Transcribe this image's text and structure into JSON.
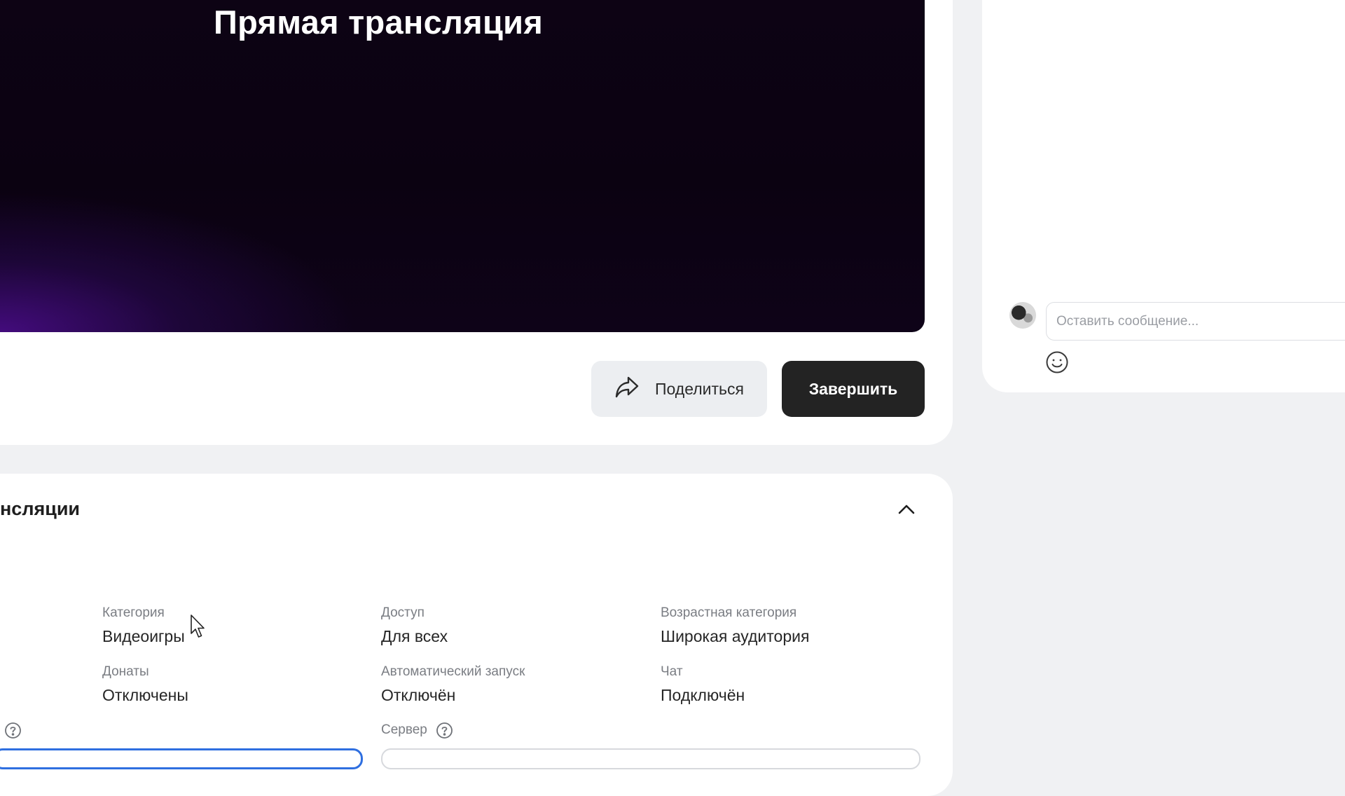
{
  "video": {
    "title": "Прямая трансляция"
  },
  "actions": {
    "share_label": "Поделиться",
    "share_icon": "share-arrow-icon",
    "finish_label": "Завершить"
  },
  "settings": {
    "title_partial": "нсляции",
    "collapse_icon": "chevron-up-icon",
    "fields": {
      "category": {
        "label": "Категория",
        "value": "Видеоигры"
      },
      "access": {
        "label": "Доступ",
        "value": "Для всех"
      },
      "age": {
        "label": "Возрастная категория",
        "value": "Широкая аудитория"
      },
      "donations": {
        "label": "Донаты",
        "value": "Отключены"
      },
      "autostart": {
        "label": "Автоматический запуск",
        "value": "Отключён"
      },
      "chat": {
        "label": "Чат",
        "value": "Подключён"
      },
      "server": {
        "label": "Сервер"
      }
    }
  },
  "chat": {
    "message_placeholder": "Оставить сообщение...",
    "emoji_icon": "smiley-icon"
  },
  "colors": {
    "page_bg": "#f0f1f3",
    "card_bg": "#ffffff",
    "finish_button_bg": "#232323",
    "share_button_bg": "#eceef1",
    "focus_blue": "#2f6fe0"
  }
}
